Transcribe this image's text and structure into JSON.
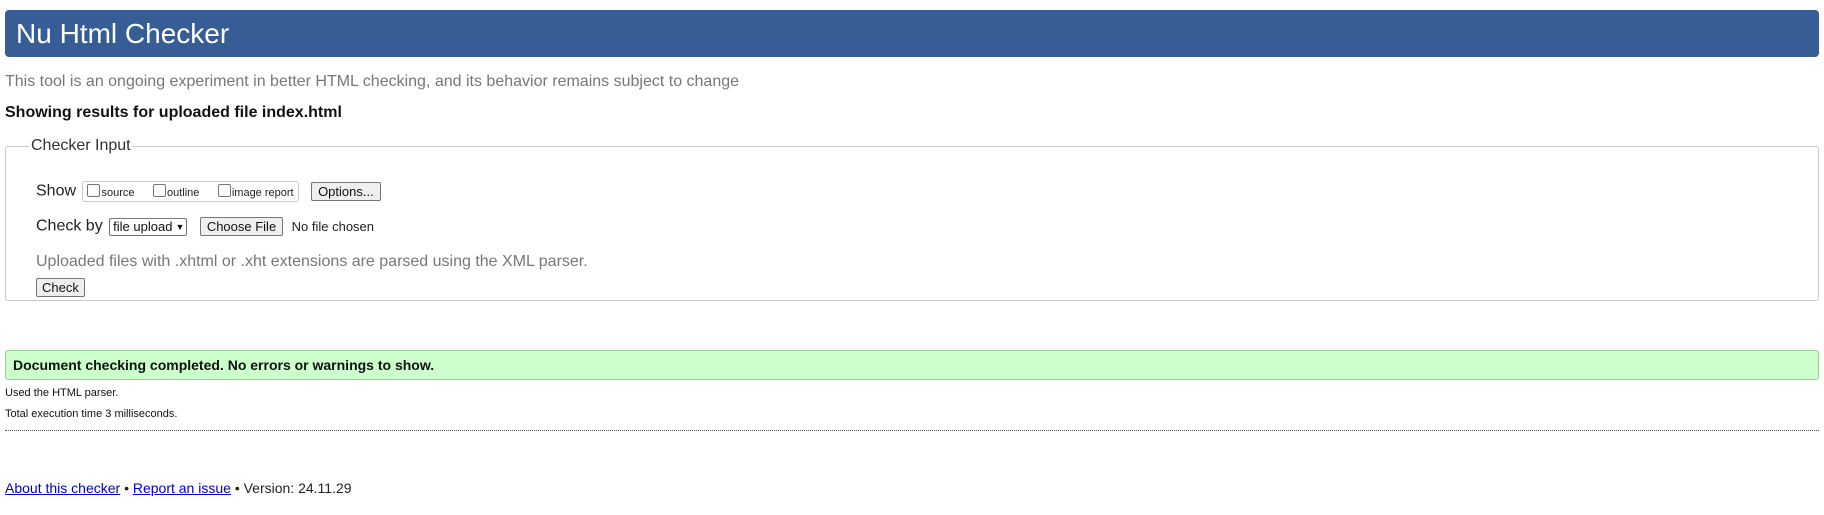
{
  "header": {
    "title": "Nu Html Checker",
    "bg_color": "#365d95"
  },
  "tagline": "This tool is an ongoing experiment in better HTML checking, and its behavior remains subject to change",
  "results_heading": "Showing results for uploaded file index.html",
  "checker_input": {
    "legend": "Checker Input",
    "show_label": "Show",
    "show_options": [
      {
        "label": "source",
        "checked": false
      },
      {
        "label": "outline",
        "checked": false
      },
      {
        "label": "image report",
        "checked": false
      }
    ],
    "options_button": "Options...",
    "check_by_label": "Check by",
    "check_by_selected": "file upload",
    "choose_file_button": "Choose File",
    "file_status": "No file chosen",
    "note": "Uploaded files with .xhtml or .xht extensions are parsed using the XML parser.",
    "check_button": "Check"
  },
  "result": {
    "message": "Document checking completed. No errors or warnings to show.",
    "bg_color": "#ccffcc",
    "details": [
      "Used the HTML parser.",
      "Total execution time 3 milliseconds."
    ]
  },
  "footer": {
    "about_link": "About this checker",
    "separator": "•",
    "report_link": "Report an issue",
    "version": "Version: 24.11.29"
  }
}
